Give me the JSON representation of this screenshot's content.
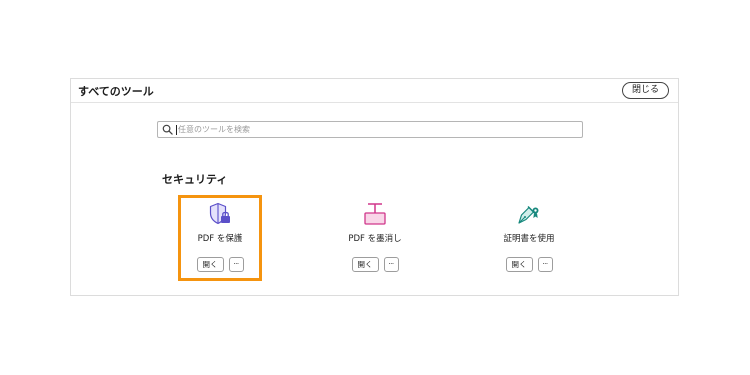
{
  "panel": {
    "title": "すべてのツール",
    "close_label": "閉じる"
  },
  "search": {
    "placeholder": "任意のツールを検索",
    "icon": "search-icon"
  },
  "section": {
    "title": "セキュリティ"
  },
  "tools": [
    {
      "label": "PDF を保護",
      "icon": "shield-lock-icon",
      "open_label": "開く",
      "more_label": "···",
      "accent": "#5b4fc9",
      "highlighted": true,
      "highlight_color": "#f5940f"
    },
    {
      "label": "PDF を墨消し",
      "icon": "redact-icon",
      "open_label": "開く",
      "more_label": "···",
      "accent": "#d0368a",
      "highlighted": false
    },
    {
      "label": "証明書を使用",
      "icon": "certificate-pen-icon",
      "open_label": "開く",
      "more_label": "···",
      "accent": "#17887d",
      "highlighted": false
    }
  ]
}
